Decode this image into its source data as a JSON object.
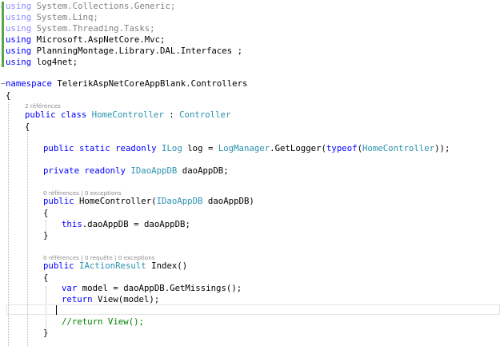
{
  "editor": {
    "usings": [
      {
        "keyword": "using",
        "ns": "System.Collections.Generic;"
      },
      {
        "keyword": "using",
        "ns": "System.Linq;"
      },
      {
        "keyword": "using",
        "ns": "System.Threading.Tasks;"
      },
      {
        "keyword": "using",
        "ns": "Microsoft.AspNetCore.Mvc;"
      },
      {
        "keyword": "using",
        "ns": "PlanningMontage.Library.DAL.Interfaces ;"
      },
      {
        "keyword": "using",
        "ns": "log4net;"
      }
    ],
    "namespace_line": {
      "keyword": "namespace",
      "name": "TelerikAspNetCoreAppBlank.Controllers"
    },
    "open_brace": "{",
    "close_brace": "}",
    "class_codelens": "2 références",
    "class_line": {
      "kw1": "public",
      "kw2": "class",
      "name": "HomeController",
      "sep": " : ",
      "base": "Controller"
    },
    "log_field": {
      "kw1": "public",
      "kw2": "static",
      "kw3": "readonly",
      "type": "ILog",
      "mid": " log = ",
      "manager": "LogManager",
      "call": ".GetLogger(",
      "typeof_kw": "typeof",
      "paren": "(",
      "arg_type": "HomeController",
      "end": "));"
    },
    "dao_field": {
      "kw1": "private",
      "kw2": "readonly",
      "type": "IDaoAppDB",
      "rest": " daoAppDB;"
    },
    "ctor_codelens": "0 références | 0 exceptions",
    "ctor_line": {
      "kw": "public",
      "name": " HomeController(",
      "param_type": "IDaoAppDB",
      "rest": " daoAppDB)"
    },
    "ctor_body": {
      "kw": "this",
      "rest": ".daoAppDB = daoAppDB;"
    },
    "index_codelens": "0 références | 0 requête | 0 exceptions",
    "index_line": {
      "kw": "public",
      "ret_type": "IActionResult",
      "rest": " Index()"
    },
    "var_line": {
      "kw": "var",
      "rest": " model = daoAppDB.GetMissings();"
    },
    "return_line": {
      "kw": "return",
      "rest": " View(model);"
    },
    "comment_line": "//return View();"
  },
  "colors": {
    "keyword": "#0000ff",
    "type": "#2b91af",
    "comment": "#008000",
    "dimmed": "#808080",
    "codelens": "#8a8a8a",
    "change_marker": "#57a64a"
  }
}
